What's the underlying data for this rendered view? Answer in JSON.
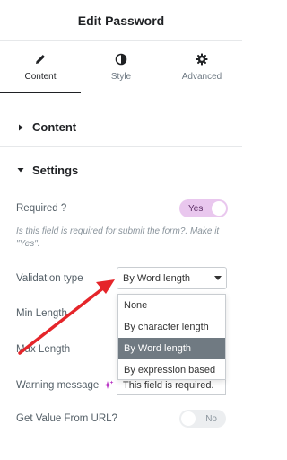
{
  "header": {
    "title": "Edit Password"
  },
  "tabs": [
    {
      "label": "Content",
      "icon": "pencil-icon",
      "active": true
    },
    {
      "label": "Style",
      "icon": "half-circle-icon",
      "active": false
    },
    {
      "label": "Advanced",
      "icon": "gear-icon",
      "active": false
    }
  ],
  "sections": {
    "content": {
      "title": "Content",
      "expanded": false
    },
    "settings": {
      "title": "Settings",
      "expanded": true
    }
  },
  "fields": {
    "required": {
      "label": "Required ?",
      "toggle_text": "Yes",
      "hint": "Is this field is required for submit the form?. Make it \"Yes\"."
    },
    "validation_type": {
      "label": "Validation type",
      "selected": "By Word length",
      "options": [
        "None",
        "By character length",
        "By Word length",
        "By expression based"
      ]
    },
    "min_length": {
      "label": "Min Length"
    },
    "max_length": {
      "label": "Max Length"
    },
    "warning_message": {
      "label": "Warning message",
      "value": "This field is required."
    },
    "get_value_from_url": {
      "label": "Get Value From URL?",
      "toggle_text": "No"
    }
  },
  "colors": {
    "toggle_on": "#e9c7ee",
    "selected_option": "#707a82",
    "annotation_arrow": "#e5252a",
    "ai_icon": "#b832c4"
  }
}
